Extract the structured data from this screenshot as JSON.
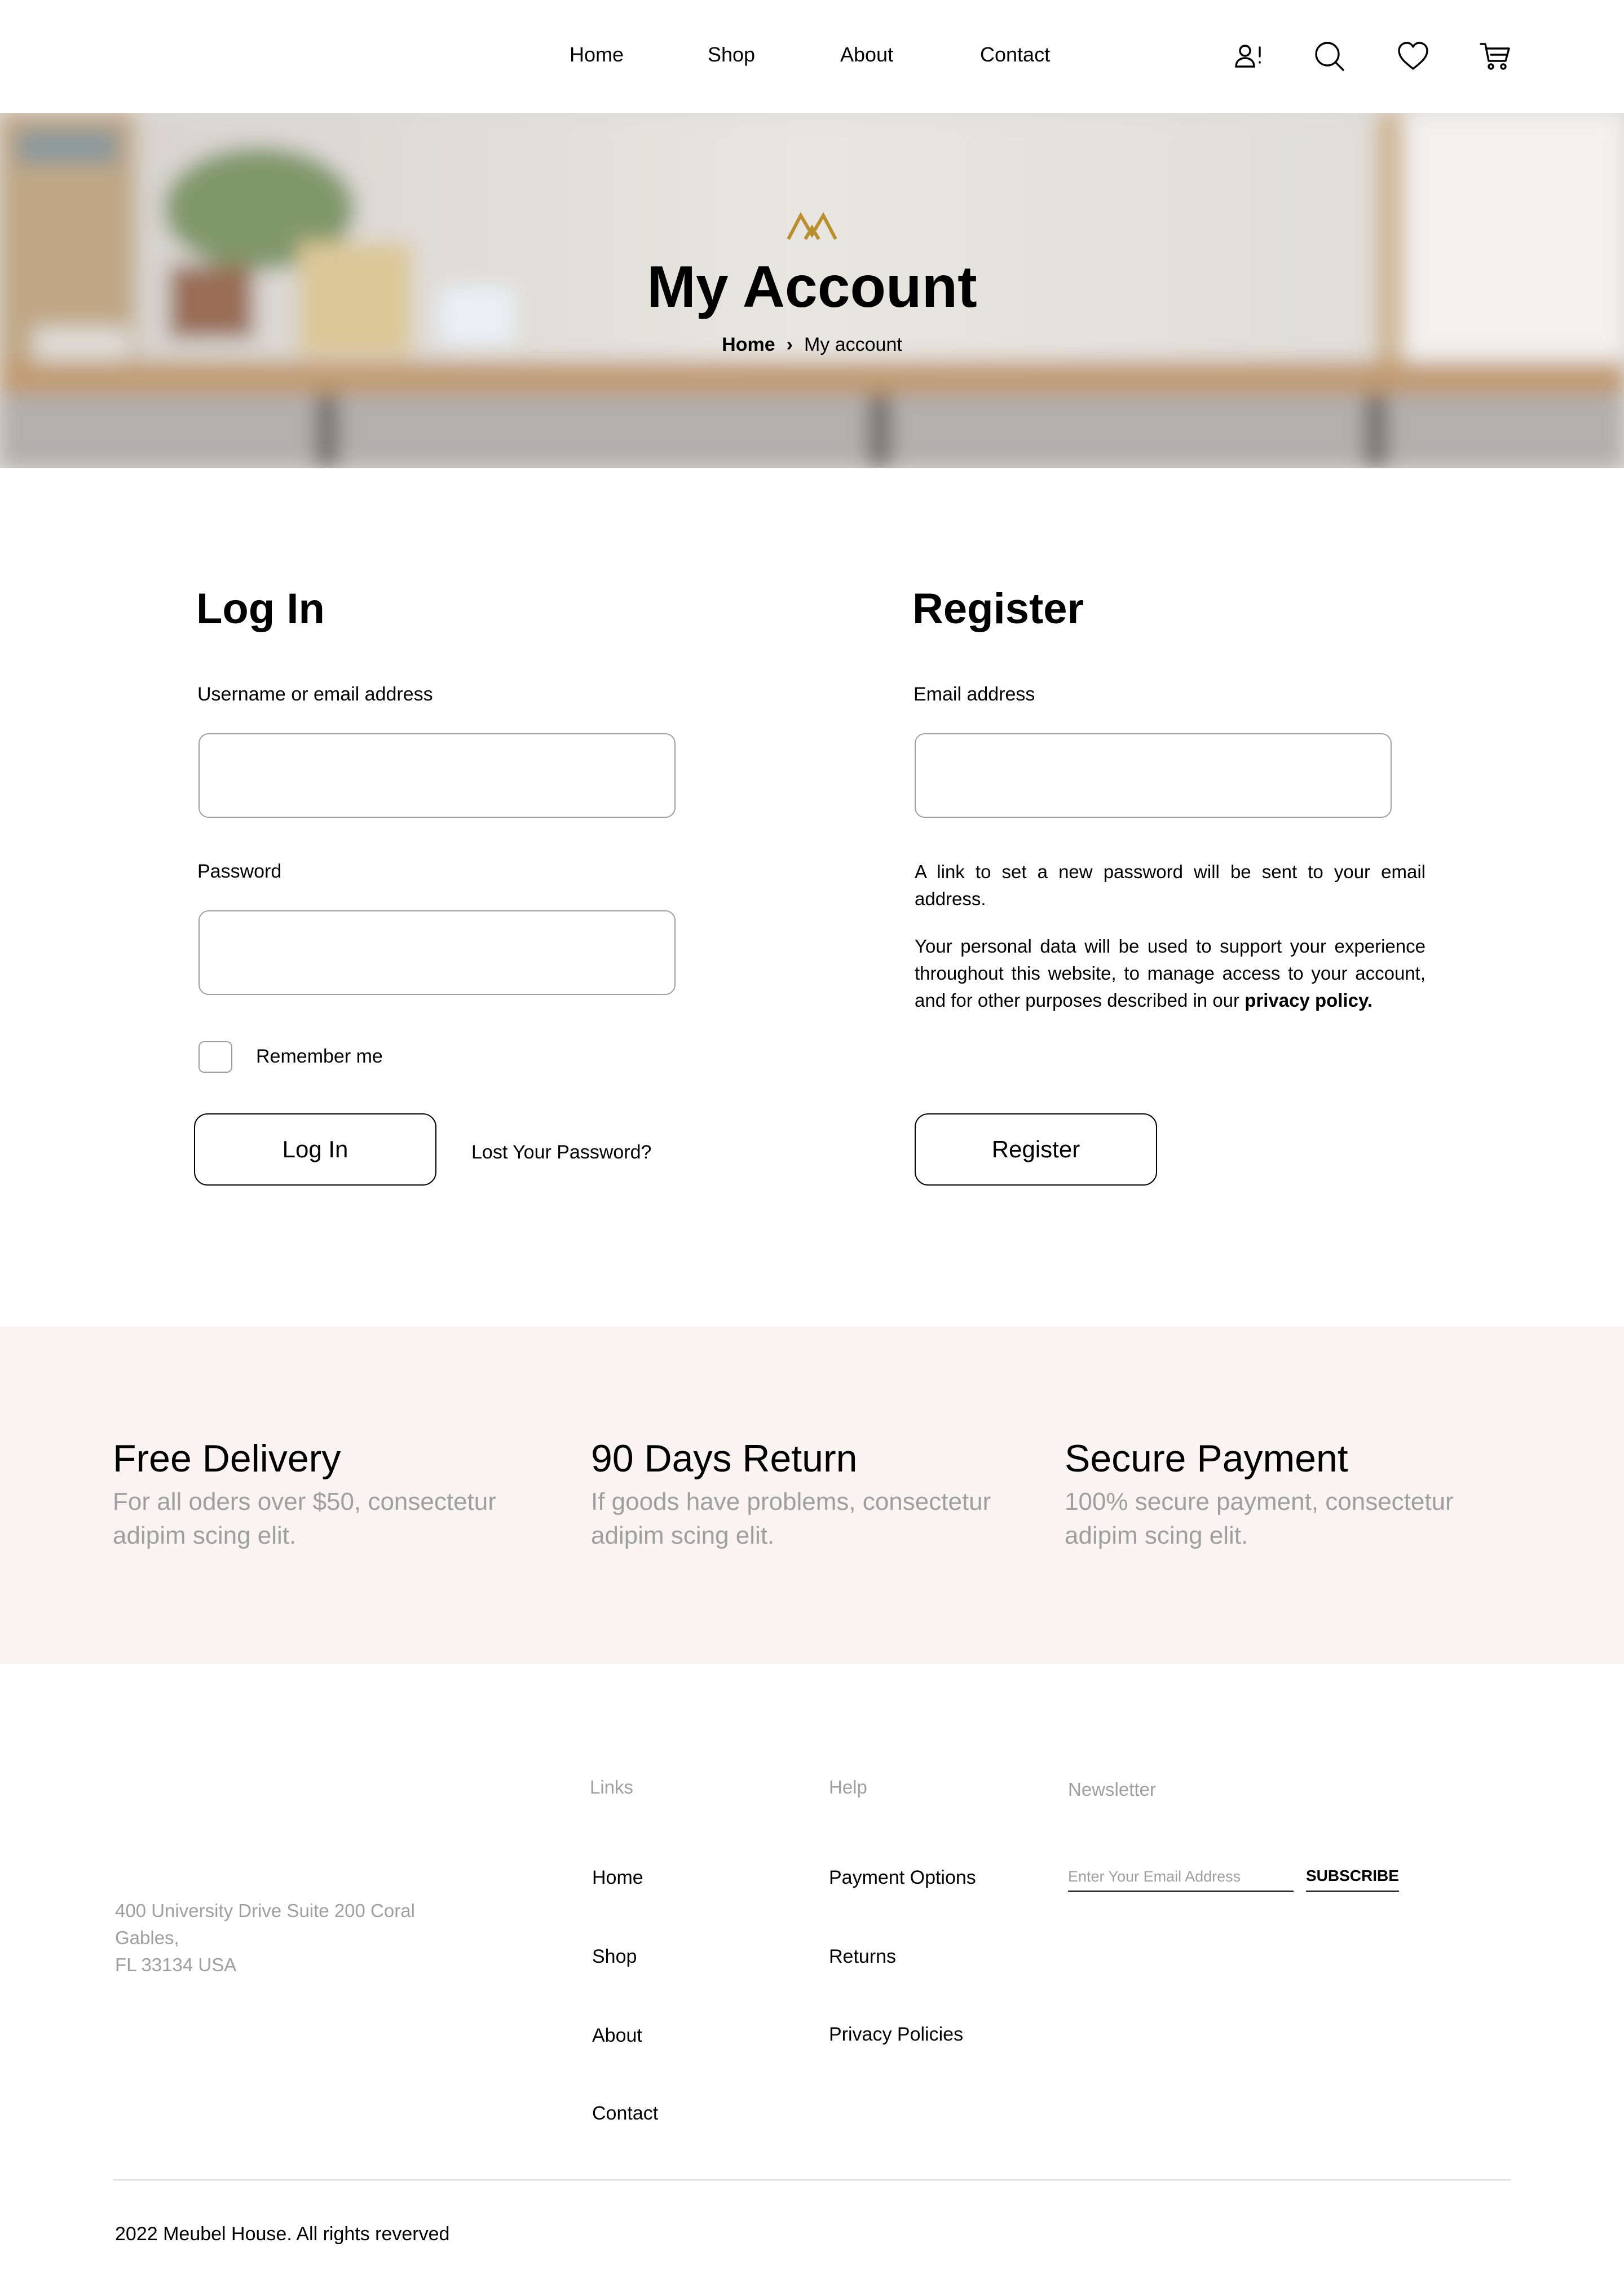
{
  "nav": {
    "items": [
      {
        "label": "Home"
      },
      {
        "label": "Shop"
      },
      {
        "label": "About"
      },
      {
        "label": "Contact"
      }
    ],
    "icons": [
      "user-alert-icon",
      "search-icon",
      "heart-icon",
      "cart-icon"
    ]
  },
  "hero": {
    "title": "My Account",
    "breadcrumb": {
      "home": "Home",
      "separator": "›",
      "current": "My account"
    },
    "logo_color": "#B88E2F"
  },
  "login": {
    "title": "Log In",
    "username_label": "Username or email address",
    "username_value": "",
    "password_label": "Password",
    "password_value": "",
    "remember_label": "Remember me",
    "remember_checked": false,
    "submit_label": "Log In",
    "lost_password": "Lost Your Password?"
  },
  "register": {
    "title": "Register",
    "email_label": "Email address",
    "email_value": "",
    "info_text": "A link to set a new password will be sent to your email address.",
    "privacy_text": "Your personal data will be used to support your experience throughout this website, to manage access to your account, and for other purposes described in our",
    "privacy_link": "privacy policy.",
    "submit_label": "Register"
  },
  "features": [
    {
      "title": "Free Delivery",
      "text": "For all oders over $50, consectetur adipim scing elit."
    },
    {
      "title": "90 Days Return",
      "text": "If goods have problems, consectetur adipim scing elit."
    },
    {
      "title": "Secure Payment",
      "text": "100% secure payment, consectetur adipim scing elit."
    }
  ],
  "footer": {
    "address_line1": "400 University Drive Suite 200 Coral",
    "address_line2": "Gables,",
    "address_line3": "FL 33134 USA",
    "links_title": "Links",
    "links": [
      "Home",
      "Shop",
      "About",
      "Contact"
    ],
    "help_title": "Help",
    "help": [
      "Payment Options",
      "Returns",
      "Privacy Policies"
    ],
    "newsletter_title": "Newsletter",
    "newsletter_placeholder": "Enter Your Email Address",
    "subscribe_label": "SUBSCRIBE",
    "copyright": "2022 Meubel House. All rights reverved"
  },
  "colors": {
    "accent": "#B88E2F",
    "features_bg": "#F9F3F2",
    "muted_text": "#9F9F9F",
    "input_border": "#9F9F9F"
  }
}
